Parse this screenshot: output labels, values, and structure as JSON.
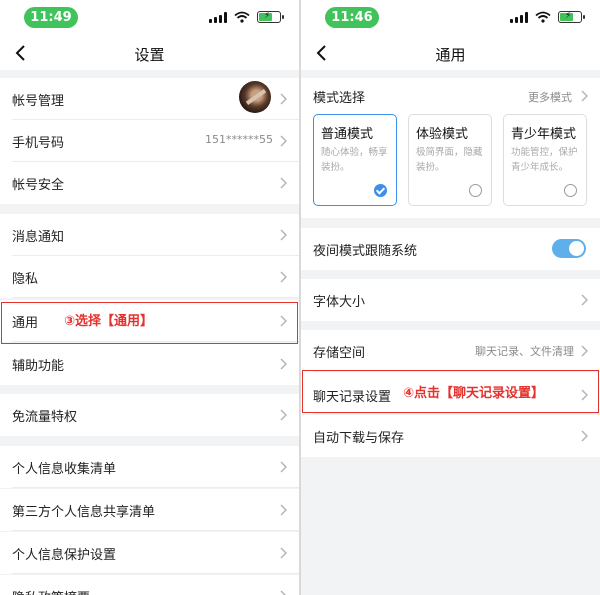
{
  "left": {
    "status": {
      "time": "11:49"
    },
    "nav": {
      "title": "设置"
    },
    "items": [
      {
        "label": "帐号管理",
        "value": ""
      },
      {
        "label": "手机号码",
        "value": "151******55"
      },
      {
        "label": "帐号安全",
        "value": ""
      },
      {
        "label": "消息通知",
        "value": ""
      },
      {
        "label": "隐私",
        "value": ""
      },
      {
        "label": "通用",
        "value": ""
      },
      {
        "label": "辅助功能",
        "value": ""
      },
      {
        "label": "免流量特权",
        "value": ""
      },
      {
        "label": "个人信息收集清单",
        "value": ""
      },
      {
        "label": "第三方个人信息共享清单",
        "value": ""
      },
      {
        "label": "个人信息保护设置",
        "value": ""
      },
      {
        "label": "隐私政策摘要",
        "value": ""
      }
    ],
    "annotation": "③选择【通用】"
  },
  "right": {
    "status": {
      "time": "11:46"
    },
    "nav": {
      "title": "通用"
    },
    "mode_section": {
      "label": "模式选择",
      "more": "更多模式",
      "modes": [
        {
          "title": "普通模式",
          "desc": "随心体验，畅享装扮。",
          "selected": true
        },
        {
          "title": "体验模式",
          "desc": "极简界面，隐藏装扮。",
          "selected": false
        },
        {
          "title": "青少年模式",
          "desc": "功能管控，保护青少年成长。",
          "selected": false
        }
      ]
    },
    "night_mode": {
      "label": "夜间模式跟随系统",
      "on": true
    },
    "font_size": {
      "label": "字体大小"
    },
    "storage": {
      "label": "存储空间",
      "value": "聊天记录、文件清理"
    },
    "chat_settings": {
      "label": "聊天记录设置"
    },
    "auto_download": {
      "label": "自动下载与保存"
    },
    "annotation": "④点击【聊天记录设置】"
  },
  "colors": {
    "accent": "#3f8ee8",
    "annotation": "#e5322d",
    "status_time": "#3fc35a",
    "toggle": "#5fb0ea"
  }
}
